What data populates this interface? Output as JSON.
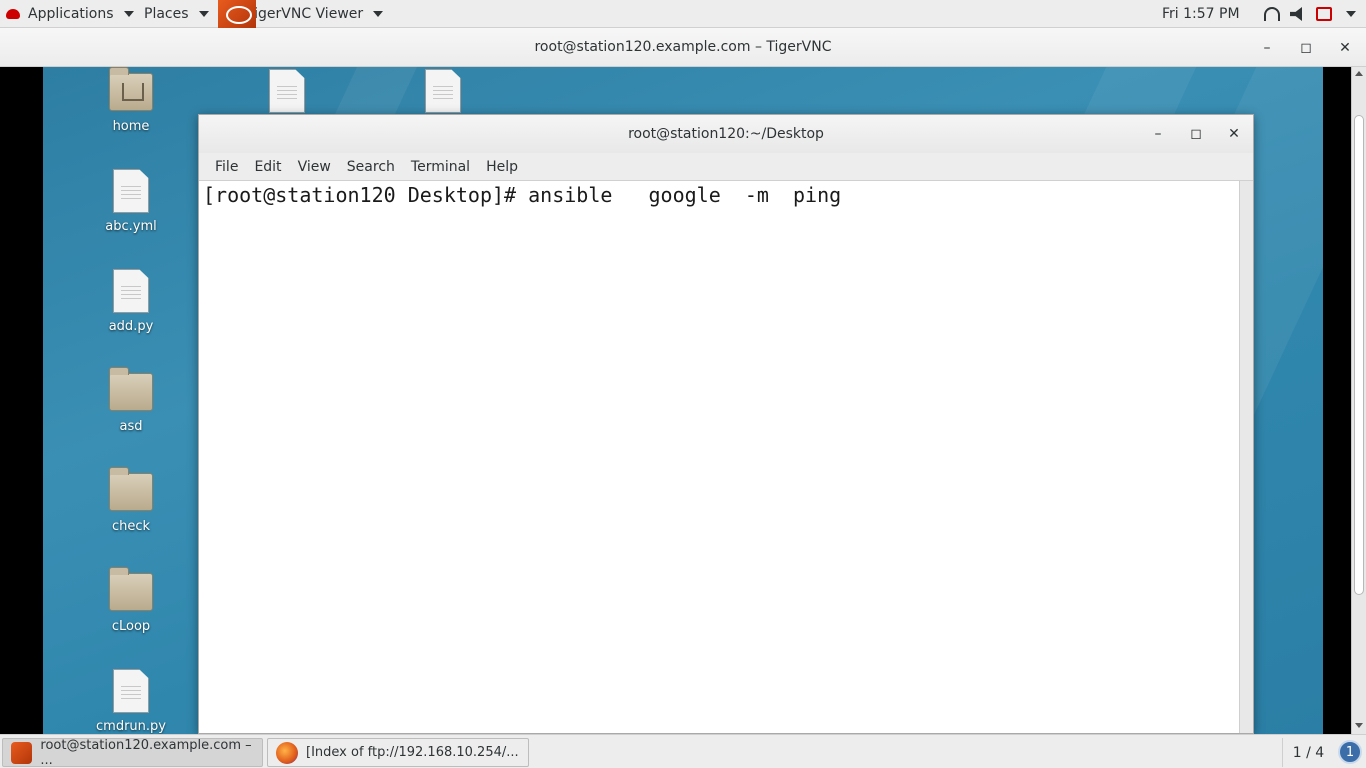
{
  "top_panel": {
    "applications_label": "Applications",
    "places_label": "Places",
    "active_app_label": "TigerVNC Viewer",
    "clock": "Fri  1:57 PM"
  },
  "vnc_window": {
    "title": "root@station120.example.com – TigerVNC"
  },
  "desktop": {
    "icons": [
      {
        "label": "home",
        "type": "folder-home"
      },
      {
        "label": "abc.yml",
        "type": "file"
      },
      {
        "label": "add.py",
        "type": "file"
      },
      {
        "label": "asd",
        "type": "folder"
      },
      {
        "label": "check",
        "type": "folder"
      },
      {
        "label": "cLoop",
        "type": "folder"
      },
      {
        "label": "cmdrun.py",
        "type": "file"
      }
    ]
  },
  "terminal": {
    "title": "root@station120:~/Desktop",
    "menu": [
      "File",
      "Edit",
      "View",
      "Search",
      "Terminal",
      "Help"
    ],
    "line1": "[root@station120 Desktop]# ansible   google  -m  ping"
  },
  "taskbar": {
    "task1": "root@station120.example.com – ...",
    "task2": "[Index of ftp://192.168.10.254/...",
    "workspace": "1 / 4",
    "notification_count": "1"
  },
  "colors": {
    "desktop_bg": "#3087ad",
    "panel_bg": "#ededed",
    "redhat": "#cc0000"
  }
}
